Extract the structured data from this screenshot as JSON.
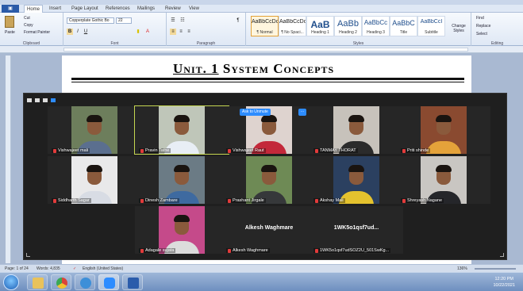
{
  "ribbon": {
    "tabs": [
      "Home",
      "Insert",
      "Page Layout",
      "References",
      "Mailings",
      "Review",
      "View"
    ],
    "clipboard": {
      "paste": "Paste",
      "cut": "Cut",
      "copy": "Copy",
      "format_painter": "Format Painter",
      "label": "Clipboard"
    },
    "font": {
      "name": "Copperplate Gothic Bo",
      "size": "22",
      "label": "Font"
    },
    "paragraph_label": "Paragraph",
    "styles": [
      {
        "sample": "AaBbCcDc",
        "name": "¶ Normal",
        "selected": true
      },
      {
        "sample": "AaBbCcDc",
        "name": "¶ No Spaci...",
        "selected": false
      },
      {
        "sample": "AaB",
        "name": "Heading 1",
        "selected": false
      },
      {
        "sample": "AaBb",
        "name": "Heading 2",
        "selected": false
      },
      {
        "sample": "AaBbCc",
        "name": "Heading 3",
        "selected": false
      },
      {
        "sample": "AaBbC",
        "name": "Title",
        "selected": false
      },
      {
        "sample": "AaBbCcI",
        "name": "Subtitle",
        "selected": false
      }
    ],
    "styles_label": "Styles",
    "change_styles": "Change Styles",
    "editing": {
      "find": "Find",
      "replace": "Replace",
      "select": "Select",
      "label": "Editing"
    }
  },
  "document": {
    "title_prefix": "Unit. 1",
    "title_rest": " System Concepts"
  },
  "meeting": {
    "ask_to_unmute": "Ask to Unmute",
    "more": "···",
    "participants": [
      {
        "name": "Vishwajeet mali",
        "shirt": "#5b6f8f",
        "bg": "#6d7e5c"
      },
      {
        "name": "Pravin Tathe",
        "shirt": "#e8eef5",
        "bg": "#bfc6b9"
      },
      {
        "name": "Vishwajeet Raut",
        "shirt": "#c3283a",
        "bg": "#ded3cf"
      },
      {
        "name": "TANMAY THORAT",
        "shirt": "#2b2b2b",
        "bg": "#c7c2bb"
      },
      {
        "name": "Priti shinde",
        "shirt": "#e4a23a",
        "bg": "#8a4a30"
      },
      {
        "name": "Siddharth Sagar",
        "shirt": "#d8dce4",
        "bg": "#e9e9ea"
      },
      {
        "name": "Dinesh Zambare",
        "shirt": "#3e6aa0",
        "bg": "#6b7b85"
      },
      {
        "name": "Prashant Jirgale",
        "shirt": "#36383a",
        "bg": "#6e8a55"
      },
      {
        "name": "Akshay Mali",
        "shirt": "#e4c22e",
        "bg": "#2b4060"
      },
      {
        "name": "Shreyash Nagane",
        "shirt": "#25262a",
        "bg": "#c9c6c2"
      },
      {
        "name": "Adagale sujata",
        "shirt": "#dcdcdc",
        "bg": "#c54a8a"
      },
      {
        "name": "Alkesh Waghmare",
        "center": "Alkesh Waghmare"
      },
      {
        "name": "1WK5o1qsf7udSOZ2U_501SwKg...",
        "center": "1WK5o1qsf7ud..."
      }
    ]
  },
  "status": {
    "page": "Page: 1 of 24",
    "words": "Words: 4,835",
    "language": "English (United States)",
    "zoom": "136%"
  },
  "taskbar": {
    "time": "12:20 PM",
    "date": "10/22/2021"
  }
}
